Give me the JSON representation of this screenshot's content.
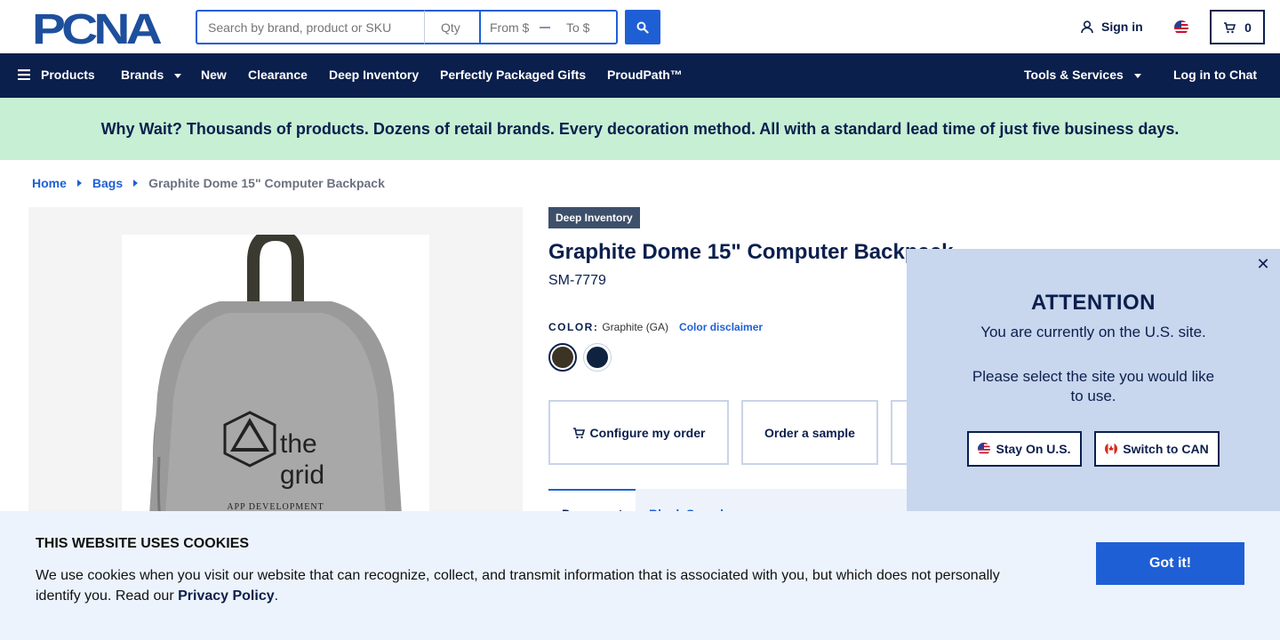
{
  "brand": {
    "logo_text": "PCNA",
    "primary_color": "#0b1f4d",
    "accent_color": "#1f5fd6",
    "promo_bg": "#c6efd4"
  },
  "search": {
    "placeholder": "Search by brand, product or SKU",
    "qty_placeholder": "Qty",
    "from_placeholder": "From $",
    "to_placeholder": "To $",
    "button_icon": "search-icon"
  },
  "account": {
    "sign_in_label": "Sign in",
    "sign_in_icon": "user-icon",
    "region_icon": "us-flag-icon",
    "cart_count": "0",
    "cart_icon": "cart-icon"
  },
  "nav": {
    "products": "Products",
    "brands": "Brands",
    "new": "New",
    "clearance": "Clearance",
    "deep_inventory": "Deep Inventory",
    "gifts": "Perfectly Packaged Gifts",
    "proudpath": "ProudPath™",
    "tools": "Tools & Services",
    "chat": "Log in to Chat"
  },
  "promo": {
    "text": "Why Wait? Thousands of products. Dozens of retail brands. Every decoration method. All with a standard lead time of just five business days."
  },
  "breadcrumb": {
    "home": "Home",
    "category": "Bags",
    "current": "Graphite Dome 15\" Computer Backpack"
  },
  "product": {
    "badge": "Deep Inventory",
    "title": "Graphite Dome 15\" Computer Backpack",
    "sku": "SM-7779",
    "color_label": "COLOR:",
    "color_value": "Graphite (GA)",
    "color_disclaimer": "Color disclaimer",
    "swatches": [
      {
        "color": "#3b3323"
      },
      {
        "color": "#0f2340"
      }
    ],
    "image_logo_line1": "the",
    "image_logo_line2": "grid",
    "image_logo_line3": "APP DEVELOPMENT",
    "configure_label": "Configure my order",
    "sample_label": "Order a sample",
    "tab_active": "Document",
    "tab_other": "Blank Sample"
  },
  "attention": {
    "title": "ATTENTION",
    "message": "You are currently on the U.S. site.",
    "prompt": "Please select the site you would like to use.",
    "stay_label": "Stay On U.S.",
    "switch_label": "Switch to CAN"
  },
  "cookie": {
    "title": "THIS WEBSITE USES COOKIES",
    "text": "We use cookies when you visit our website that can recognize, collect, and transmit information that is associated with you, but which does not personally identify you. Read our ",
    "privacy_link": "Privacy Policy",
    "period": ".",
    "button": "Got it!"
  }
}
